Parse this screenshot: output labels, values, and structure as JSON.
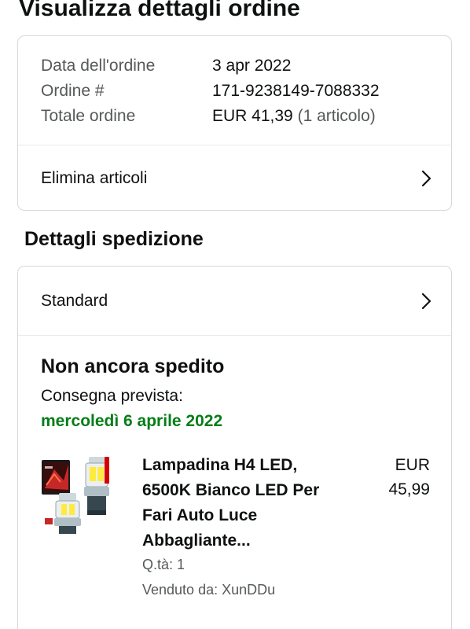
{
  "page": {
    "title": "Visualizza dettagli ordine"
  },
  "order_summary": {
    "rows": [
      {
        "label": "Data dell'ordine",
        "value": "3 apr 2022"
      },
      {
        "label": "Ordine #",
        "value": "171-9238149-7088332"
      },
      {
        "label": "Totale ordine",
        "value": "EUR 41,39",
        "extra": "(1 articolo)"
      }
    ],
    "delete_items_label": "Elimina articoli",
    "chevron_icon": "chevron-right-icon"
  },
  "shipping": {
    "section_title": "Dettagli spedizione",
    "method_label": "Standard",
    "status": "Non ancora spedito",
    "delivery_label": "Consegna prevista:",
    "delivery_date": "mercoledì 6 aprile 2022",
    "delivery_date_color": "#067d19",
    "item": {
      "image_icon": "product-image",
      "title": "Lampadina H4 LED, 6500K Bianco LED Per Fari Auto Luce Abbagliante...",
      "price_currency": "EUR",
      "price_value": "45,99",
      "quantity": "Q.tà: 1",
      "seller": "Venduto da: XunDDu"
    }
  },
  "colors": {
    "text_primary": "#0f1111",
    "text_secondary": "#565959",
    "border": "#d5d9d9"
  }
}
